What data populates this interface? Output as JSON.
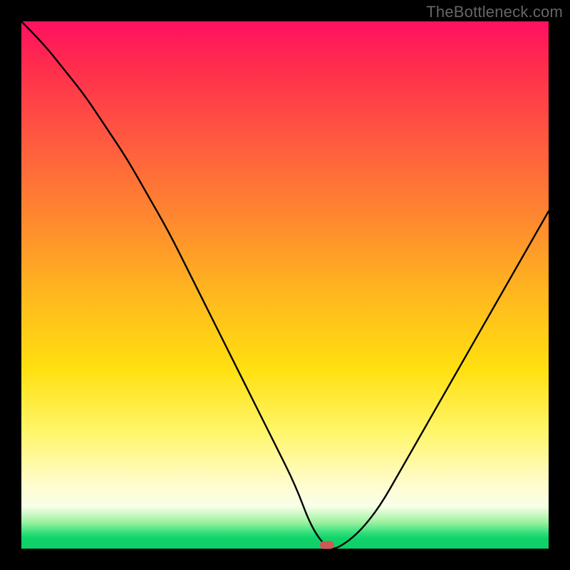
{
  "watermark": "TheBottleneck.com",
  "colors": {
    "frame": "#000000",
    "watermark_text": "#666666",
    "curve_stroke": "#000000",
    "marker_fill": "#cc5a55",
    "gradient_top": "#ff1060",
    "gradient_bottom": "#0ecf68"
  },
  "chart_data": {
    "type": "line",
    "title": "",
    "xlabel": "",
    "ylabel": "",
    "xlim": [
      0,
      100
    ],
    "ylim": [
      0,
      100
    ],
    "x": [
      0,
      4,
      8,
      12,
      16,
      20,
      24,
      28,
      32,
      36,
      40,
      44,
      48,
      52,
      55,
      58,
      60,
      64,
      68,
      72,
      76,
      80,
      84,
      88,
      92,
      96,
      100
    ],
    "values": [
      100,
      96,
      91,
      86,
      80,
      74,
      67,
      60,
      52,
      44,
      36,
      28,
      20,
      12,
      4,
      0,
      0,
      3,
      8,
      15,
      22,
      29,
      36,
      43,
      50,
      57,
      64
    ],
    "flat_bottom_x": [
      55,
      60
    ],
    "marker": {
      "x": 58,
      "y": 0
    },
    "gradient_meaning": "background color represents bottleneck severity: top (red/magenta) = high, bottom (green) = none",
    "note": "No axis ticks or numeric labels are rendered in the image; x/y are normalized 0–100 estimates read off the geometry."
  }
}
